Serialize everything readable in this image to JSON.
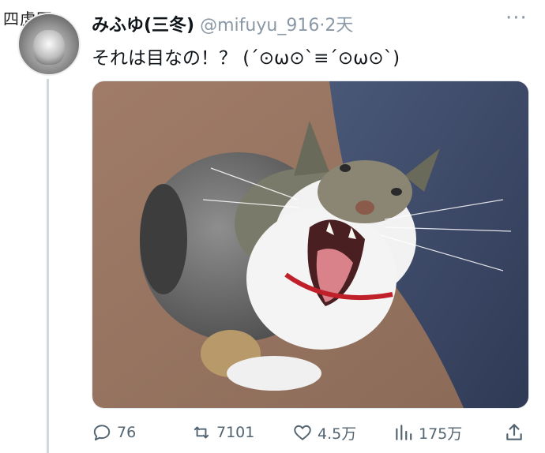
{
  "watermark": "四虎网",
  "tweet": {
    "display_name": "みふゆ(三冬)",
    "handle": "@mifuyu_916",
    "separator": "·",
    "time": "2天",
    "text": "それは目なの！？ (´⊙ω⊙`≡´⊙ω⊙`)"
  },
  "icons": {
    "more": "more-icon",
    "reply": "reply-icon",
    "retweet": "retweet-icon",
    "like": "heart-icon",
    "views": "views-icon",
    "share": "share-icon"
  },
  "actions": {
    "replies": "76",
    "retweets": "7101",
    "likes": "4.5万",
    "views": "175万"
  },
  "colors": {
    "text": "#0f1419",
    "muted": "#536471",
    "thread_line": "#cfd9de"
  }
}
